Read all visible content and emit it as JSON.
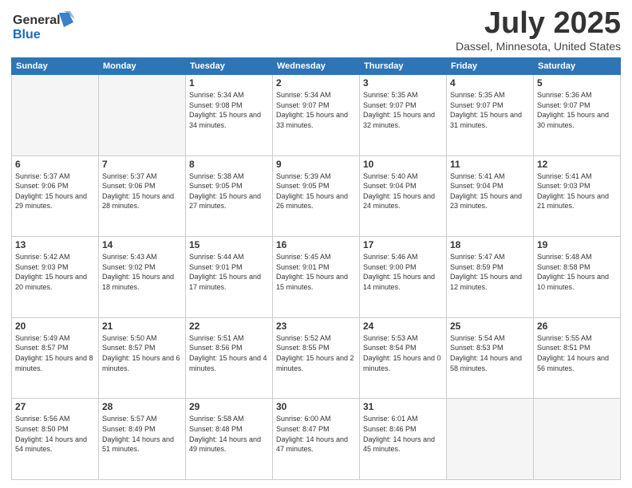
{
  "header": {
    "logo_line1": "General",
    "logo_line2": "Blue",
    "month": "July 2025",
    "location": "Dassel, Minnesota, United States"
  },
  "weekdays": [
    "Sunday",
    "Monday",
    "Tuesday",
    "Wednesday",
    "Thursday",
    "Friday",
    "Saturday"
  ],
  "weeks": [
    [
      {
        "day": "",
        "empty": true
      },
      {
        "day": "",
        "empty": true
      },
      {
        "day": "1",
        "sunrise": "Sunrise: 5:34 AM",
        "sunset": "Sunset: 9:08 PM",
        "daylight": "Daylight: 15 hours and 34 minutes."
      },
      {
        "day": "2",
        "sunrise": "Sunrise: 5:34 AM",
        "sunset": "Sunset: 9:07 PM",
        "daylight": "Daylight: 15 hours and 33 minutes."
      },
      {
        "day": "3",
        "sunrise": "Sunrise: 5:35 AM",
        "sunset": "Sunset: 9:07 PM",
        "daylight": "Daylight: 15 hours and 32 minutes."
      },
      {
        "day": "4",
        "sunrise": "Sunrise: 5:35 AM",
        "sunset": "Sunset: 9:07 PM",
        "daylight": "Daylight: 15 hours and 31 minutes."
      },
      {
        "day": "5",
        "sunrise": "Sunrise: 5:36 AM",
        "sunset": "Sunset: 9:07 PM",
        "daylight": "Daylight: 15 hours and 30 minutes."
      }
    ],
    [
      {
        "day": "6",
        "sunrise": "Sunrise: 5:37 AM",
        "sunset": "Sunset: 9:06 PM",
        "daylight": "Daylight: 15 hours and 29 minutes."
      },
      {
        "day": "7",
        "sunrise": "Sunrise: 5:37 AM",
        "sunset": "Sunset: 9:06 PM",
        "daylight": "Daylight: 15 hours and 28 minutes."
      },
      {
        "day": "8",
        "sunrise": "Sunrise: 5:38 AM",
        "sunset": "Sunset: 9:05 PM",
        "daylight": "Daylight: 15 hours and 27 minutes."
      },
      {
        "day": "9",
        "sunrise": "Sunrise: 5:39 AM",
        "sunset": "Sunset: 9:05 PM",
        "daylight": "Daylight: 15 hours and 26 minutes."
      },
      {
        "day": "10",
        "sunrise": "Sunrise: 5:40 AM",
        "sunset": "Sunset: 9:04 PM",
        "daylight": "Daylight: 15 hours and 24 minutes."
      },
      {
        "day": "11",
        "sunrise": "Sunrise: 5:41 AM",
        "sunset": "Sunset: 9:04 PM",
        "daylight": "Daylight: 15 hours and 23 minutes."
      },
      {
        "day": "12",
        "sunrise": "Sunrise: 5:41 AM",
        "sunset": "Sunset: 9:03 PM",
        "daylight": "Daylight: 15 hours and 21 minutes."
      }
    ],
    [
      {
        "day": "13",
        "sunrise": "Sunrise: 5:42 AM",
        "sunset": "Sunset: 9:03 PM",
        "daylight": "Daylight: 15 hours and 20 minutes."
      },
      {
        "day": "14",
        "sunrise": "Sunrise: 5:43 AM",
        "sunset": "Sunset: 9:02 PM",
        "daylight": "Daylight: 15 hours and 18 minutes."
      },
      {
        "day": "15",
        "sunrise": "Sunrise: 5:44 AM",
        "sunset": "Sunset: 9:01 PM",
        "daylight": "Daylight: 15 hours and 17 minutes."
      },
      {
        "day": "16",
        "sunrise": "Sunrise: 5:45 AM",
        "sunset": "Sunset: 9:01 PM",
        "daylight": "Daylight: 15 hours and 15 minutes."
      },
      {
        "day": "17",
        "sunrise": "Sunrise: 5:46 AM",
        "sunset": "Sunset: 9:00 PM",
        "daylight": "Daylight: 15 hours and 14 minutes."
      },
      {
        "day": "18",
        "sunrise": "Sunrise: 5:47 AM",
        "sunset": "Sunset: 8:59 PM",
        "daylight": "Daylight: 15 hours and 12 minutes."
      },
      {
        "day": "19",
        "sunrise": "Sunrise: 5:48 AM",
        "sunset": "Sunset: 8:58 PM",
        "daylight": "Daylight: 15 hours and 10 minutes."
      }
    ],
    [
      {
        "day": "20",
        "sunrise": "Sunrise: 5:49 AM",
        "sunset": "Sunset: 8:57 PM",
        "daylight": "Daylight: 15 hours and 8 minutes."
      },
      {
        "day": "21",
        "sunrise": "Sunrise: 5:50 AM",
        "sunset": "Sunset: 8:57 PM",
        "daylight": "Daylight: 15 hours and 6 minutes."
      },
      {
        "day": "22",
        "sunrise": "Sunrise: 5:51 AM",
        "sunset": "Sunset: 8:56 PM",
        "daylight": "Daylight: 15 hours and 4 minutes."
      },
      {
        "day": "23",
        "sunrise": "Sunrise: 5:52 AM",
        "sunset": "Sunset: 8:55 PM",
        "daylight": "Daylight: 15 hours and 2 minutes."
      },
      {
        "day": "24",
        "sunrise": "Sunrise: 5:53 AM",
        "sunset": "Sunset: 8:54 PM",
        "daylight": "Daylight: 15 hours and 0 minutes."
      },
      {
        "day": "25",
        "sunrise": "Sunrise: 5:54 AM",
        "sunset": "Sunset: 8:53 PM",
        "daylight": "Daylight: 14 hours and 58 minutes."
      },
      {
        "day": "26",
        "sunrise": "Sunrise: 5:55 AM",
        "sunset": "Sunset: 8:51 PM",
        "daylight": "Daylight: 14 hours and 56 minutes."
      }
    ],
    [
      {
        "day": "27",
        "sunrise": "Sunrise: 5:56 AM",
        "sunset": "Sunset: 8:50 PM",
        "daylight": "Daylight: 14 hours and 54 minutes."
      },
      {
        "day": "28",
        "sunrise": "Sunrise: 5:57 AM",
        "sunset": "Sunset: 8:49 PM",
        "daylight": "Daylight: 14 hours and 51 minutes."
      },
      {
        "day": "29",
        "sunrise": "Sunrise: 5:58 AM",
        "sunset": "Sunset: 8:48 PM",
        "daylight": "Daylight: 14 hours and 49 minutes."
      },
      {
        "day": "30",
        "sunrise": "Sunrise: 6:00 AM",
        "sunset": "Sunset: 8:47 PM",
        "daylight": "Daylight: 14 hours and 47 minutes."
      },
      {
        "day": "31",
        "sunrise": "Sunrise: 6:01 AM",
        "sunset": "Sunset: 8:46 PM",
        "daylight": "Daylight: 14 hours and 45 minutes."
      },
      {
        "day": "",
        "empty": true
      },
      {
        "day": "",
        "empty": true
      }
    ]
  ]
}
